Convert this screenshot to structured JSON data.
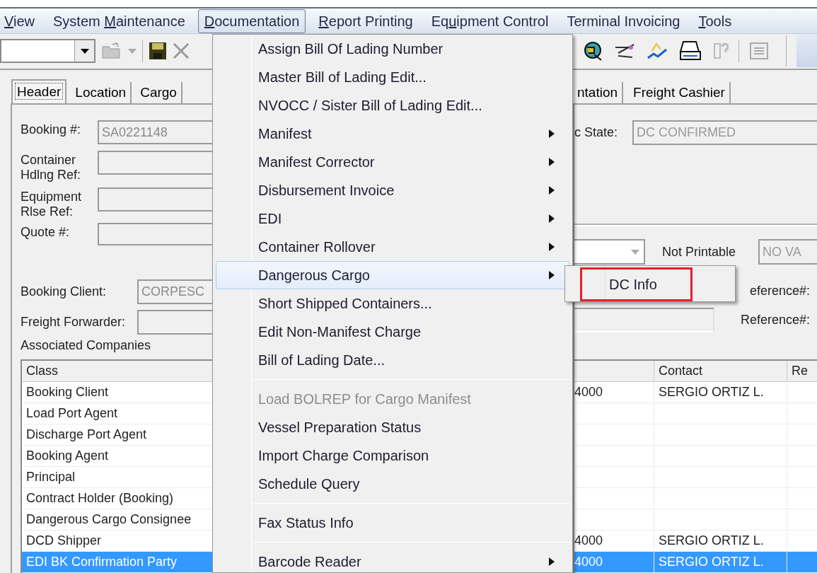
{
  "menu_bar": [
    {
      "access_key": "V",
      "text_after": "iew",
      "selected": false
    },
    {
      "text_before": "System ",
      "access_key": "M",
      "text_after": "aintenance",
      "selected": false
    },
    {
      "access_key": "D",
      "text_after": "ocumentation",
      "selected": true
    },
    {
      "access_key": "R",
      "text_after": "eport Printing",
      "selected": false
    },
    {
      "text_before": "Eq",
      "access_key": "u",
      "text_after": "ipment Control",
      "selected": false
    },
    {
      "text_before": "Terminal Invoicing",
      "selected": false
    },
    {
      "access_key": "T",
      "text_after": "ools",
      "selected": false
    }
  ],
  "tabs": {
    "left": [
      {
        "label": "Header",
        "selected": true
      },
      {
        "label": "Location",
        "selected": false
      },
      {
        "label": "Cargo",
        "selected": false
      }
    ],
    "right": [
      {
        "label": "ntation",
        "selected": false
      },
      {
        "label": "Freight Cashier",
        "selected": false
      }
    ]
  },
  "header_form": {
    "top_fields": [
      {
        "label": "Booking #:",
        "value": "SA0221148"
      },
      {
        "label": "Container Hdlng Ref:"
      },
      {
        "label": "Equipment Rlse Ref:"
      },
      {
        "label": "Quote #:"
      }
    ],
    "party_fields": [
      {
        "label": "Booking Client:",
        "value": "CORPESC"
      },
      {
        "label": "Freight Forwarder:"
      }
    ],
    "dc_state": {
      "label": "c State:",
      "value": "DC CONFIRMED"
    },
    "print_option": {
      "label": "Not Printable",
      "value": "NO VA"
    },
    "reference_labels": [
      "eference#:",
      "Reference#:"
    ]
  },
  "associated_companies": {
    "title": "Associated Companies",
    "columns": {
      "class": "Class",
      "contact": "Contact",
      "column_4": "Re"
    },
    "rows": [
      {
        "class": "Booking Client",
        "column_2": "4000",
        "contact": "SERGIO ORTIZ L.",
        "selected": false
      },
      {
        "class": "Load Port Agent",
        "selected": false
      },
      {
        "class": "Discharge Port Agent",
        "selected": false
      },
      {
        "class": "Booking Agent",
        "selected": false
      },
      {
        "class": "Principal",
        "selected": false
      },
      {
        "class": "Contract Holder (Booking)",
        "selected": false
      },
      {
        "class": "Dangerous Cargo Consignee",
        "selected": false
      },
      {
        "class": "DCD Shipper",
        "column_2": "4000",
        "contact": "SERGIO ORTIZ L.",
        "selected": false
      },
      {
        "class": "EDI BK Confirmation Party",
        "column_2": "4000",
        "contact": "SERGIO ORTIZ L.",
        "selected": true
      }
    ]
  },
  "documentation_menu": {
    "items": [
      {
        "kind": "item",
        "label": "Assign Bill Of Lading Number",
        "has_submenu": false,
        "disabled": false,
        "highlighted": false
      },
      {
        "kind": "item",
        "label": "Master Bill of Lading Edit...",
        "has_submenu": false,
        "disabled": false,
        "highlighted": false
      },
      {
        "kind": "item",
        "label": "NVOCC / Sister Bill of Lading Edit...",
        "has_submenu": false,
        "disabled": false,
        "highlighted": false
      },
      {
        "kind": "item",
        "label": "Manifest",
        "has_submenu": true,
        "disabled": false,
        "highlighted": false
      },
      {
        "kind": "item",
        "label": "Manifest Corrector",
        "has_submenu": true,
        "disabled": false,
        "highlighted": false
      },
      {
        "kind": "item",
        "label": "Disbursement Invoice",
        "has_submenu": true,
        "disabled": false,
        "highlighted": false
      },
      {
        "kind": "item",
        "label": "EDI",
        "has_submenu": true,
        "disabled": false,
        "highlighted": false
      },
      {
        "kind": "item",
        "label": "Container Rollover",
        "has_submenu": true,
        "disabled": false,
        "highlighted": false
      },
      {
        "kind": "item",
        "label": "Dangerous Cargo",
        "has_submenu": true,
        "disabled": false,
        "highlighted": true
      },
      {
        "kind": "item",
        "label": "Short Shipped Containers...",
        "has_submenu": false,
        "disabled": false,
        "highlighted": false
      },
      {
        "kind": "item",
        "label": "Edit Non-Manifest Charge",
        "has_submenu": false,
        "disabled": false,
        "highlighted": false
      },
      {
        "kind": "item",
        "label": "Bill of Lading Date...",
        "has_submenu": false,
        "disabled": false,
        "highlighted": false
      },
      {
        "kind": "separator"
      },
      {
        "kind": "item",
        "label": "Load BOLREP for Cargo Manifest",
        "has_submenu": false,
        "disabled": true,
        "highlighted": false
      },
      {
        "kind": "item",
        "label": "Vessel Preparation Status",
        "has_submenu": false,
        "disabled": false,
        "highlighted": false
      },
      {
        "kind": "item",
        "label": "Import Charge Comparison",
        "has_submenu": false,
        "disabled": false,
        "highlighted": false
      },
      {
        "kind": "item",
        "label": "Schedule Query",
        "has_submenu": false,
        "disabled": false,
        "highlighted": false
      },
      {
        "kind": "separator"
      },
      {
        "kind": "item",
        "label": "Fax Status Info",
        "has_submenu": false,
        "disabled": false,
        "highlighted": false
      },
      {
        "kind": "separator"
      },
      {
        "kind": "item",
        "label": "Barcode Reader",
        "has_submenu": true,
        "disabled": false,
        "highlighted": false
      }
    ]
  },
  "dangerous_cargo_submenu": {
    "items": [
      {
        "label": "DC Info",
        "outlined": true
      }
    ]
  }
}
